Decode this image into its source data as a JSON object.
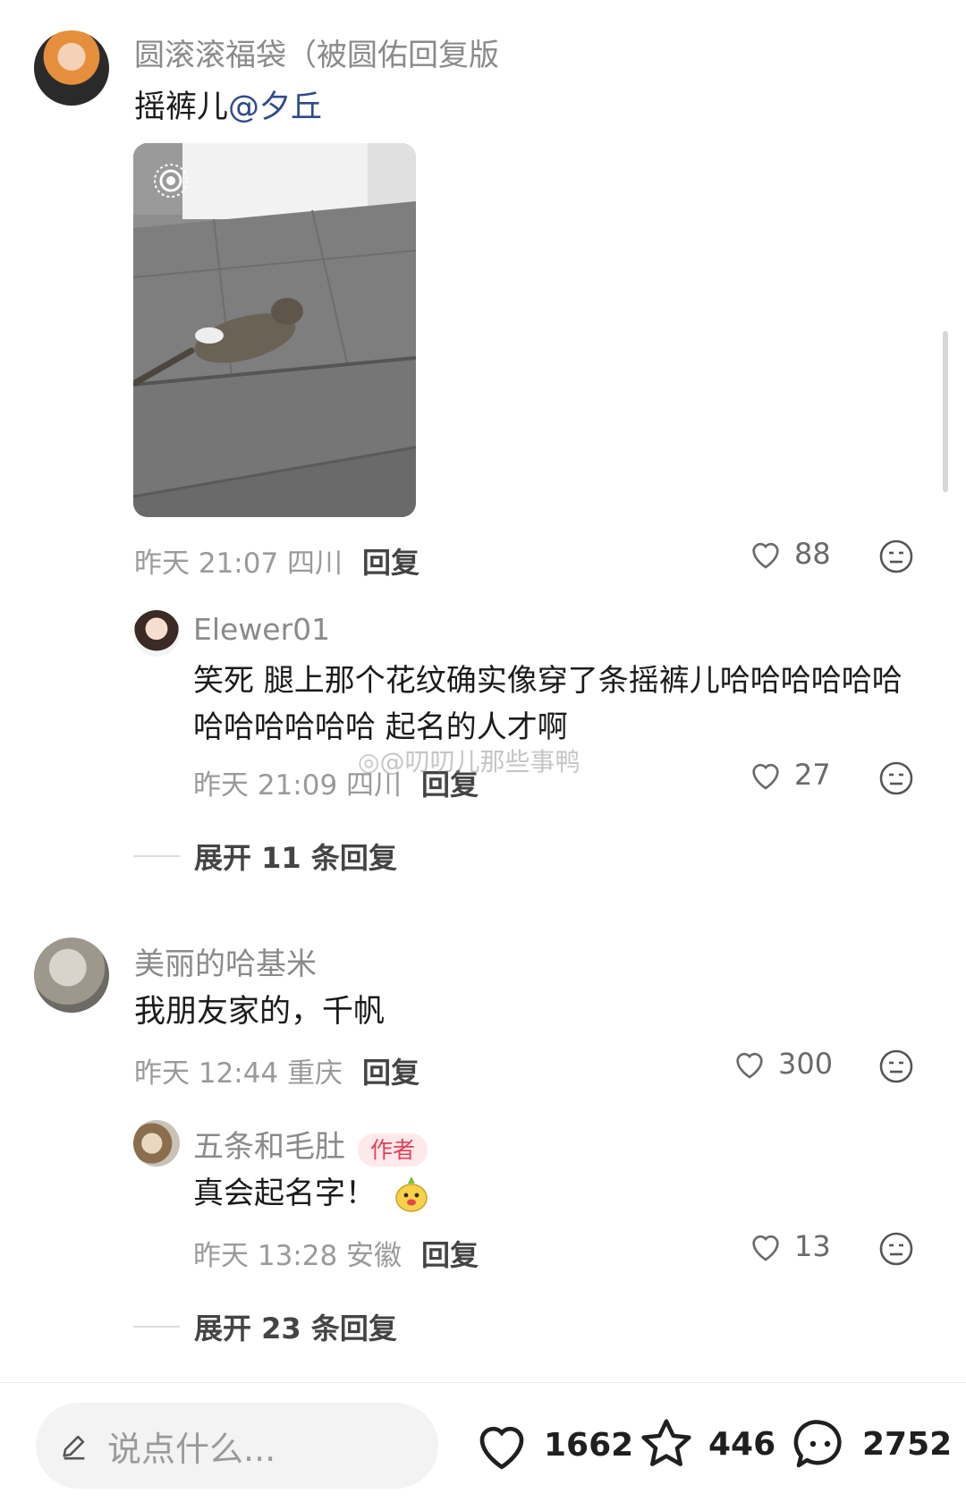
{
  "comments": [
    {
      "username": "圆滚滚福袋（被圆佑回复版",
      "text_prefix": "摇裤儿",
      "mention": "@夕丘",
      "meta": "昨天 21:07 四川",
      "reply_label": "回复",
      "likes": "88",
      "reply": {
        "username": "Elewer01",
        "text": "笑死 腿上那个花纹确实像穿了条摇裤儿哈哈哈哈哈哈哈哈哈哈哈哈 起名的人才啊",
        "meta": "昨天 21:09 四川",
        "reply_label": "回复",
        "likes": "27"
      },
      "expand": "展开 11 条回复"
    },
    {
      "username": "美丽的哈基米",
      "text": "我朋友家的，千帆",
      "meta": "昨天 12:44 重庆",
      "reply_label": "回复",
      "likes": "300",
      "reply": {
        "username": "五条和毛肚",
        "badge": "作者",
        "text": "真会起名字！",
        "meta": "昨天 13:28 安徽",
        "reply_label": "回复",
        "likes": "13"
      },
      "expand": "展开 23 条回复"
    }
  ],
  "watermark": "@叨叨儿那些事鸭",
  "bottom_bar": {
    "input_placeholder": "说点什么...",
    "likes": "1662",
    "favorites": "446",
    "comments": "2752"
  },
  "colors": {
    "mention": "#2e4a8a",
    "author_badge_bg": "#fde8ea",
    "author_badge_text": "#e0415a"
  }
}
